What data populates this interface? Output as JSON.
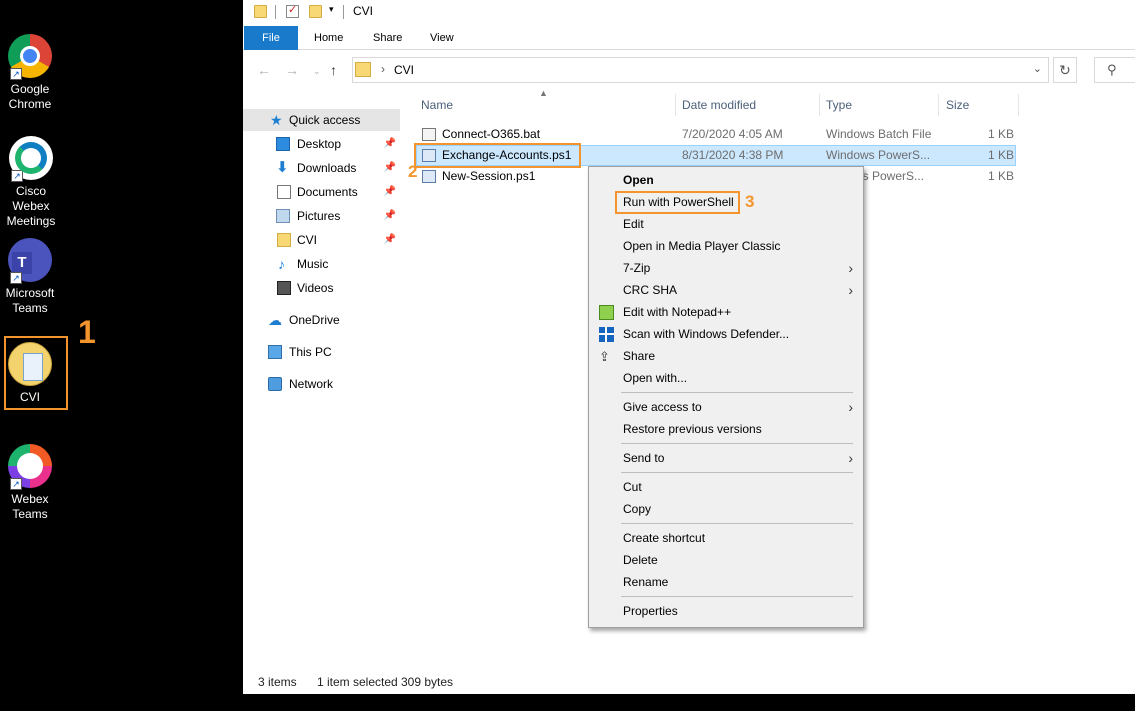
{
  "desktop": {
    "icons": [
      {
        "label": "Google\nChrome"
      },
      {
        "label": "Cisco Webex\nMeetings"
      },
      {
        "label": "Microsoft\nTeams"
      },
      {
        "label": "CVI"
      },
      {
        "label": "Webex\nTeams"
      }
    ]
  },
  "annotations": {
    "step1": "1",
    "step2": "2",
    "step3": "3",
    "color": "#f3952c"
  },
  "window": {
    "title": "CVI",
    "tabs": {
      "file": "File",
      "home": "Home",
      "share": "Share",
      "view": "View"
    },
    "address": {
      "crumb": "CVI"
    }
  },
  "nav": {
    "quick_access": "Quick access",
    "items": [
      {
        "label": "Desktop"
      },
      {
        "label": "Downloads"
      },
      {
        "label": "Documents"
      },
      {
        "label": "Pictures"
      },
      {
        "label": "CVI"
      },
      {
        "label": "Music"
      },
      {
        "label": "Videos"
      }
    ],
    "onedrive": "OneDrive",
    "thispc": "This PC",
    "network": "Network"
  },
  "files": {
    "columns": {
      "name": "Name",
      "date": "Date modified",
      "type": "Type",
      "size": "Size"
    },
    "rows": [
      {
        "name": "Connect-O365.bat",
        "date": "7/20/2020 4:05 AM",
        "type": "Windows Batch File",
        "size": "1 KB"
      },
      {
        "name": "Exchange-Accounts.ps1",
        "date": "8/31/2020 4:38 PM",
        "type": "Windows PowerS...",
        "size": "1 KB"
      },
      {
        "name": "New-Session.ps1",
        "date": "",
        "type": "ws PowerS...",
        "size": "1 KB"
      }
    ]
  },
  "status": {
    "items": "3 items",
    "selected": "1 item selected",
    "bytes": "309 bytes"
  },
  "context_menu": {
    "open": "Open",
    "run_ps": "Run with PowerShell",
    "edit": "Edit",
    "open_mpc": "Open in Media Player Classic",
    "zip": "7-Zip",
    "crc": "CRC SHA",
    "npp": "Edit with Notepad++",
    "defender": "Scan with Windows Defender...",
    "share": "Share",
    "open_with": "Open with...",
    "give_access": "Give access to",
    "restore": "Restore previous versions",
    "send_to": "Send to",
    "cut": "Cut",
    "copy": "Copy",
    "create_shortcut": "Create shortcut",
    "delete": "Delete",
    "rename": "Rename",
    "properties": "Properties"
  }
}
